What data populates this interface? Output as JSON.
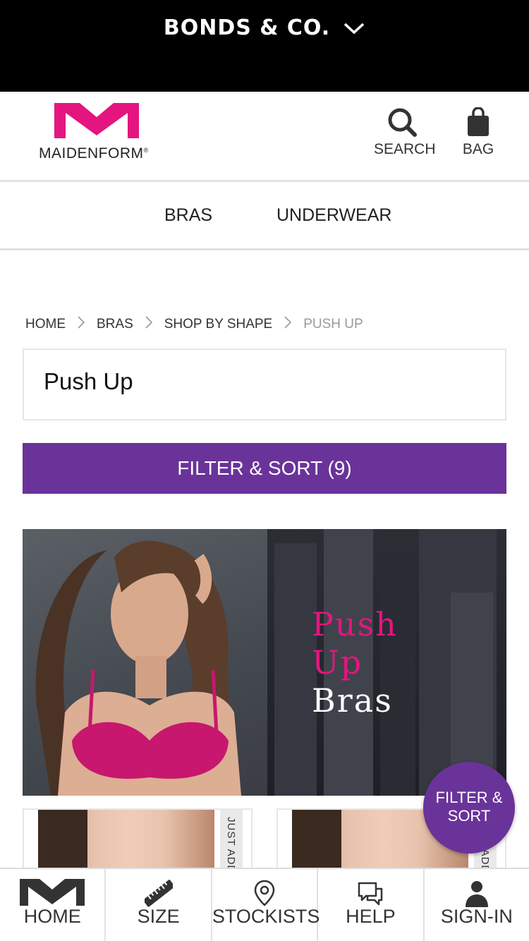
{
  "topbar": {
    "brand": "BONDS & CO.",
    "chevron_icon": "chevron-down-icon"
  },
  "header": {
    "logo_text": "MAIDENFORM",
    "logo_mark": "®",
    "search_label": "SEARCH",
    "bag_label": "BAG",
    "brand_color": "#e5157f"
  },
  "catnav": {
    "items": [
      {
        "label": "BRAS"
      },
      {
        "label": "UNDERWEAR"
      }
    ]
  },
  "breadcrumb": [
    "HOME",
    "BRAS",
    "SHOP BY SHAPE",
    "PUSH UP"
  ],
  "page": {
    "title": "Push Up"
  },
  "filter": {
    "label": "FILTER & SORT (9)",
    "accent": "#6a3399"
  },
  "banner": {
    "line1": "Push",
    "line2": "Up",
    "line3": "Bras"
  },
  "products": [
    {
      "tag": "JUST ADDED"
    },
    {
      "tag": "JUST ADDED"
    }
  ],
  "float_filter": {
    "line1": "FILTER &",
    "line2": "SORT"
  },
  "tabbar": {
    "items": [
      {
        "label": "HOME",
        "icon": "maidenform-m-icon"
      },
      {
        "label": "SIZE",
        "icon": "ruler-icon"
      },
      {
        "label": "STOCKISTS",
        "icon": "location-pin-icon"
      },
      {
        "label": "HELP",
        "icon": "chat-bubbles-icon"
      },
      {
        "label": "SIGN-IN",
        "icon": "user-icon"
      }
    ]
  }
}
